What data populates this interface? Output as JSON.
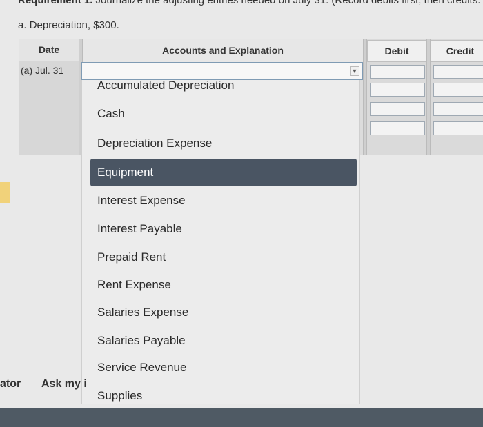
{
  "header": {
    "requirement_bold": "Requirement 1.",
    "requirement_text": " Journalize the adjusting entries needed on July 31. (Record debits first, then credits. Sele",
    "subtitle": "a. Depreciation, $300."
  },
  "table": {
    "date_header": "Date",
    "accounts_header": "Accounts and Explanation",
    "debit_header": "Debit",
    "credit_header": "Credit",
    "date_value": "(a) Jul. 31"
  },
  "dropdown": {
    "options": [
      "Accumulated Depreciation",
      "Cash",
      "Depreciation Expense",
      "Equipment",
      "Interest Expense",
      "Interest Payable",
      "Prepaid Rent",
      "Rent Expense",
      "Salaries Expense",
      "Salaries Payable",
      "Service Revenue",
      "Supplies"
    ],
    "highlighted": "Equipment"
  },
  "footer": {
    "left_text": "ator",
    "ask_text": "Ask my i"
  },
  "colors": {
    "highlight": "#4a5563",
    "bottom_bar": "#4f5a64"
  }
}
